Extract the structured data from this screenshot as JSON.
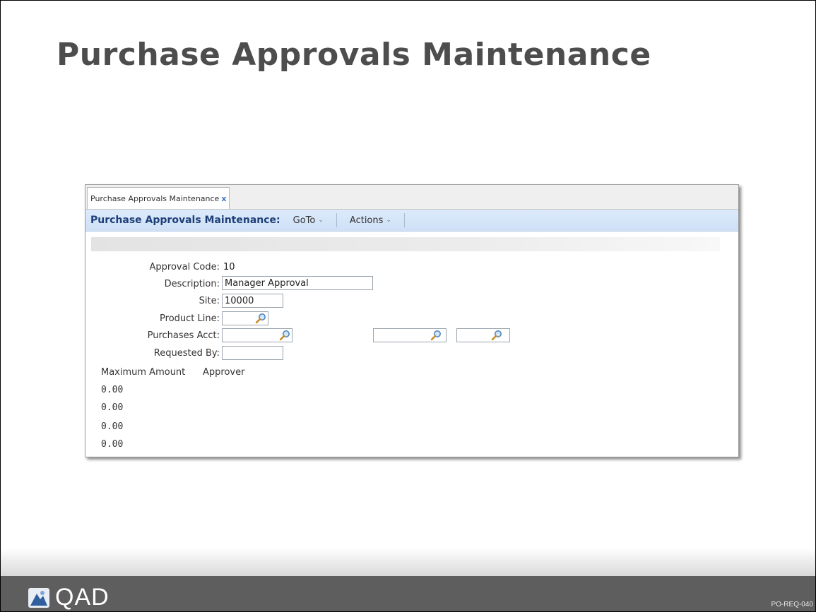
{
  "slide": {
    "title": "Purchase Approvals Maintenance",
    "slide_id": "PO-REQ-040",
    "logo_text": "QAD"
  },
  "window": {
    "tab_label": "Purchase Approvals Maintenance",
    "tab_close": "x",
    "toolbar_title": "Purchase Approvals Maintenance:",
    "goto_label": "GoTo",
    "actions_label": "Actions"
  },
  "form": {
    "approval_code_label": "Approval Code:",
    "approval_code_value": "10",
    "description_label": "Description:",
    "description_value": "Manager Approval",
    "site_label": "Site:",
    "site_value": "10000",
    "product_line_label": "Product Line:",
    "product_line_value": "",
    "purchases_acct_label": "Purchases Acct:",
    "purchases_acct_value": "",
    "purchases_acct_sub_value": "",
    "purchases_acct_cc_value": "",
    "requested_by_label": "Requested By:",
    "requested_by_value": ""
  },
  "approvers": {
    "headers": [
      "Maximum Amount",
      "Approver"
    ],
    "amounts": [
      "0.00",
      "0.00",
      "0.00",
      "0.00"
    ]
  }
}
